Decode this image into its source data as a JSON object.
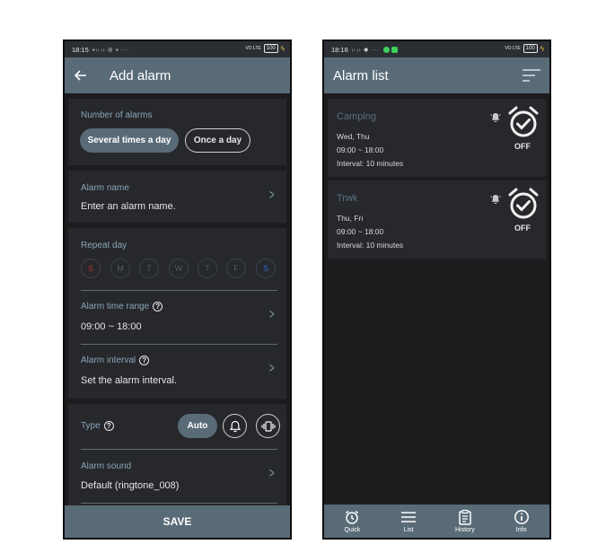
{
  "left": {
    "status": {
      "time": "18:15",
      "indicators": "⁎ᵢₗ ᵢₗ ◎ ⁎ ···",
      "volte": "VO LTE",
      "battery": "100"
    },
    "appbar": {
      "title": "Add alarm",
      "back_icon": "arrow-left-icon"
    },
    "number_of_alarms": {
      "label": "Number of alarms",
      "options": [
        "Several times a day",
        "Once a day"
      ],
      "selected": "Several times a day"
    },
    "alarm_name": {
      "label": "Alarm name",
      "placeholder": "Enter an alarm name."
    },
    "repeat_day": {
      "label": "Repeat day",
      "days": [
        "S",
        "M",
        "T",
        "W",
        "T",
        "F",
        "S"
      ]
    },
    "time_range": {
      "label": "Alarm time range",
      "value": "09:00 ~ 18:00"
    },
    "interval": {
      "label": "Alarm interval",
      "value": "Set the alarm interval."
    },
    "type": {
      "label": "Type",
      "options": [
        "Auto",
        "bell-icon",
        "vibrate-icon"
      ],
      "selected": "Auto"
    },
    "sound": {
      "label": "Alarm sound",
      "value": "Default (ringtone_008)"
    },
    "save_label": "SAVE"
  },
  "right": {
    "status": {
      "time": "18:16",
      "indicators": "ᵢₗ ᵢₗ ◉ ··· ",
      "volte": "VO LTE",
      "battery": "100"
    },
    "appbar": {
      "title": "Alarm list",
      "sort_icon": "sort-icon"
    },
    "alarms": [
      {
        "name": "Camping",
        "days": "Wed, Thu",
        "time": "09:00 ~ 18:00",
        "interval": "Interval:  10 minutes",
        "state": "OFF"
      },
      {
        "name": "Trwk",
        "days": "Thu, Fri",
        "time": "09:00 ~ 18:00",
        "interval": "Interval:  10 minutes",
        "state": "OFF"
      }
    ],
    "fab_icon": "plus-icon",
    "nav": [
      {
        "label": "Quick",
        "icon": "alarm-clock-icon"
      },
      {
        "label": "List",
        "icon": "list-icon"
      },
      {
        "label": "History",
        "icon": "clipboard-icon"
      },
      {
        "label": "Info",
        "icon": "info-icon"
      }
    ]
  },
  "colors": {
    "appbar": "#5a6b78",
    "background": "#1c1c1e",
    "card": "#26282b",
    "label": "#8ba5b8",
    "sunday": "#c0392b",
    "saturday": "#2e6fd8"
  }
}
